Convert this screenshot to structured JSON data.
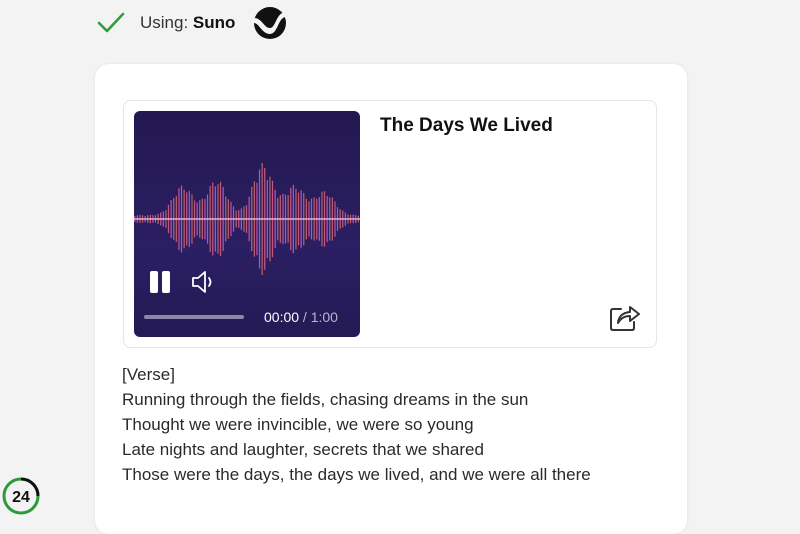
{
  "status": {
    "check_icon": "check-icon",
    "prefix": "Using: ",
    "provider": "Suno",
    "logo_icon": "suno-logo-icon",
    "check_color": "#2e9d3a"
  },
  "song": {
    "title": "The Days We Lived",
    "time_current": "00:00",
    "time_separator": " / ",
    "time_total": "1:00",
    "progress": 0,
    "artwork_bg": "#2b1f63",
    "play_state_icon": "pause-icon",
    "volume_icon": "volume-icon",
    "share_icon": "share-icon"
  },
  "lyrics": [
    "[Verse]",
    "Running through the fields, chasing dreams in the sun",
    "Thought we were invincible, we were so young",
    "Late nights and laughter, secrets that we shared",
    "Those were the days, the days we lived, and we were all there"
  ],
  "watermark": {
    "text": "24"
  }
}
